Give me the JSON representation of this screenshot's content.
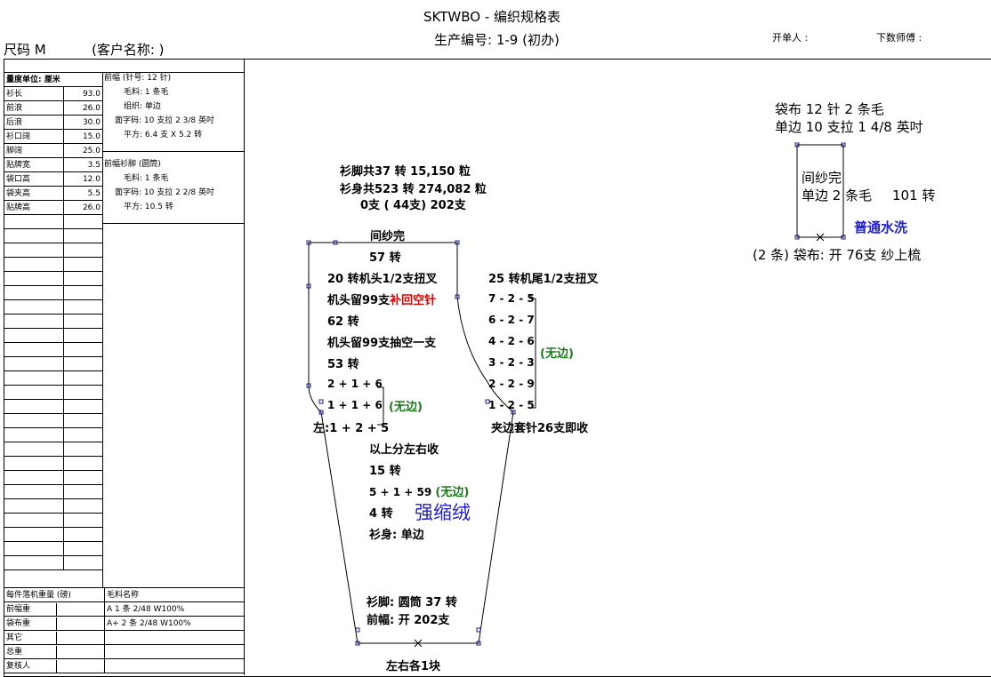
{
  "header": {
    "title": "SKTWBO - 编织规格表",
    "production_no": "生产编号: 1-9 (初办)",
    "issuer_label": "开单人 :",
    "counter_label": "下数师傅 :",
    "size_label": "尺码  M",
    "client_label": "(客户名称: )"
  },
  "measurements": {
    "unit_header": "量度单位: 厘米",
    "rows": [
      {
        "label": "衫长",
        "value": "93.0"
      },
      {
        "label": "前浪",
        "value": "26.0"
      },
      {
        "label": "后浪",
        "value": "30.0"
      },
      {
        "label": "衫口阔",
        "value": "15.0"
      },
      {
        "label": "脚阔",
        "value": "25.0"
      },
      {
        "label": "贴牌宽",
        "value": "3.5"
      },
      {
        "label": "袋口高",
        "value": "12.0"
      },
      {
        "label": "袋夹高",
        "value": "5.5"
      },
      {
        "label": "贴牌高",
        "value": "26.0"
      }
    ]
  },
  "spec_front": {
    "title": "前幅 (针号: 12 针)",
    "lines": [
      "毛料: 1 条毛",
      "组织: 单边",
      "面字码: 10 支拉 2 3/8 英吋",
      "平方: 6.4 支 X  5.2 转"
    ]
  },
  "spec_trim": {
    "title": "前幅衫脚 (圆筒)",
    "lines": [
      "毛料: 1 条毛",
      "面字码: 10 支拉 2 2/8 英吋",
      "平方: 10.5 转"
    ]
  },
  "weights": {
    "header_label": "每件落机重量 (磅)",
    "header_col": "毛料名称",
    "rows": [
      {
        "label": "前幅重",
        "value": "A  1 条 2/48 W100%"
      },
      {
        "label": "袋布重",
        "value": "A+  2 条 2/48 W100%"
      },
      {
        "label": "其它",
        "value": ""
      },
      {
        "label": "总重",
        "value": ""
      },
      {
        "label": "复核人",
        "value": ""
      }
    ]
  },
  "diagram": {
    "totals_1": "衫脚共37 转 15,150 粒",
    "totals_2": "衫身共523 转 274,082 粒",
    "totals_3": "0支 ( 44支) 202支",
    "top": "间纱完",
    "l1": "57 转",
    "l2": "20 转机头1/2支扭叉",
    "l3a": "机头留99支",
    "l3b": "补回空针",
    "l4": "62 转",
    "l5": "机头留99支抽空一支",
    "l6": "53 转",
    "l7": "2 + 1 + 6",
    "l8": "1 + 1 + 6",
    "l9": "左:1 + 2 + 5",
    "no_edge_left": "(无边)",
    "right_title": "25 转机尾1/2支扭叉",
    "r1": "7 - 2 - 5",
    "r2": "6 - 2 - 7",
    "r3": "4 - 2 - 6",
    "r4": "3 - 2 - 3",
    "r5": "2 - 2 - 9",
    "r6": "1 - 2 - 5",
    "no_edge_right": "(无边)",
    "r_bottom": "夹边套针26支即收",
    "m1": "以上分左右收",
    "m2": "15 转",
    "m3a": "5 + 1 + 59",
    "m3b": "(无边)",
    "m4": "4 转",
    "elastic": "强缩绒",
    "m5": "衫身: 单边",
    "b1": "衫脚: 圆筒  37 转",
    "b2": "前幅: 开 202支",
    "bottom": "左右各1块"
  },
  "pocket": {
    "line1": "袋布  12 针 2 条毛",
    "line2": "单边 10 支拉 1 4/8 英吋",
    "inner1": "间纱完",
    "inner2": "单边 2 条毛",
    "turns": "101 转",
    "wash": "普通水洗",
    "caption": "(2 条) 袋布: 开 76支 纱上梳"
  },
  "colors": {
    "green": "#1a7a1a",
    "red": "#e00000",
    "blue": "#2020cc",
    "handle": "#1a1a8c"
  }
}
